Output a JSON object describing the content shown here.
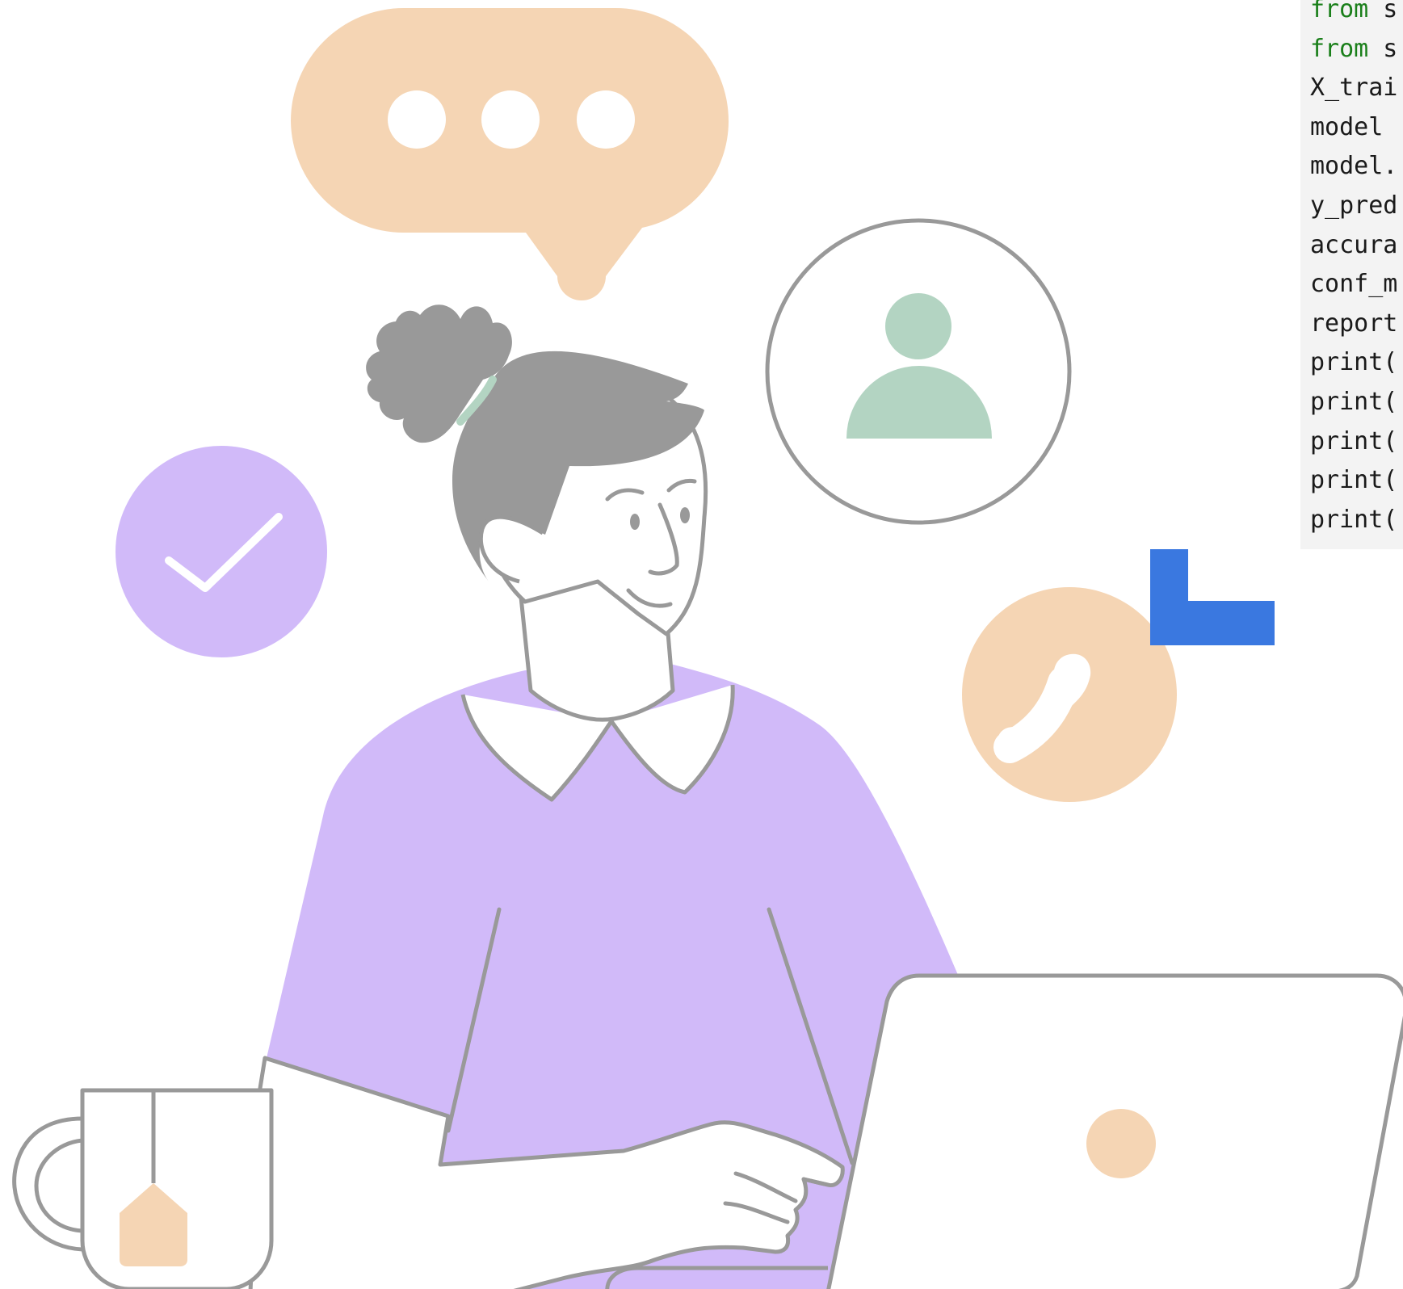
{
  "illustration": {
    "subject": "woman-working-at-laptop",
    "icons": [
      "chat-bubble-icon",
      "user-profile-icon",
      "checkmark-icon",
      "phone-icon",
      "laptop-logo-icon",
      "tea-tag-icon",
      "cursor-corner-icon"
    ]
  },
  "code_panel": {
    "lines": [
      {
        "keyword": "from",
        "rest": " s"
      },
      {
        "keyword": "from",
        "rest": " s"
      },
      {
        "keyword": "",
        "rest": "X_trai"
      },
      {
        "keyword": "",
        "rest": "model "
      },
      {
        "keyword": "",
        "rest": "model."
      },
      {
        "keyword": "",
        "rest": "y_pred"
      },
      {
        "keyword": "",
        "rest": "accura"
      },
      {
        "keyword": "",
        "rest": "conf_m"
      },
      {
        "keyword": "",
        "rest": "report"
      },
      {
        "keyword": "",
        "rest": "print("
      },
      {
        "keyword": "",
        "rest": "print("
      },
      {
        "keyword": "",
        "rest": "print("
      },
      {
        "keyword": "",
        "rest": "print("
      },
      {
        "keyword": "",
        "rest": "print("
      }
    ]
  },
  "colors": {
    "peach": "#f5d5b4",
    "lavender": "#d1baf9",
    "mint": "#b3d4c2",
    "gray": "#999999",
    "blue_accent": "#3a78e0",
    "code_background": "#f3f3f3",
    "code_keyword": "#1a7f1a"
  }
}
